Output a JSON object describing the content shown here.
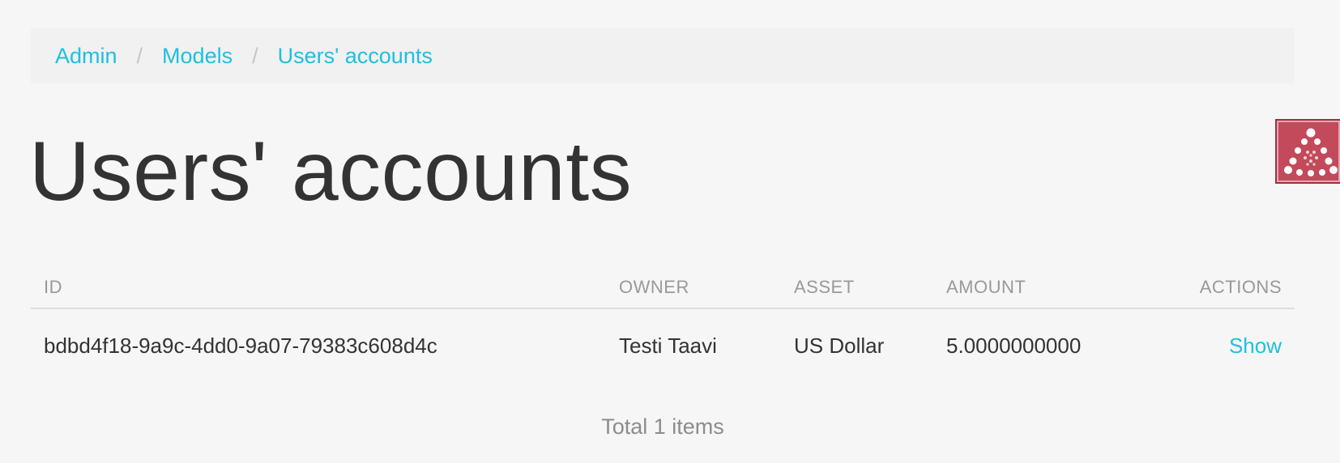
{
  "breadcrumb": {
    "items": [
      {
        "label": "Admin"
      },
      {
        "label": "Models"
      },
      {
        "label": "Users' accounts"
      }
    ],
    "separator": "/"
  },
  "page": {
    "title": "Users' accounts"
  },
  "badge": {
    "icon": "dots-pyramid-icon",
    "color": "#c24a5a"
  },
  "table": {
    "columns": {
      "id": "ID",
      "owner": "OWNER",
      "asset": "ASSET",
      "amount": "AMOUNT",
      "actions": "ACTIONS"
    },
    "rows": [
      {
        "id": "bdbd4f18-9a9c-4dd0-9a07-79383c608d4c",
        "owner": "Testi Taavi",
        "asset": "US Dollar",
        "amount": "5.0000000000",
        "action": "Show"
      }
    ]
  },
  "footer": {
    "total": "Total 1 items"
  },
  "colors": {
    "link": "#1ec0e0",
    "background": "#f6f6f6",
    "breadcrumb_bg": "#f1f1f1"
  }
}
